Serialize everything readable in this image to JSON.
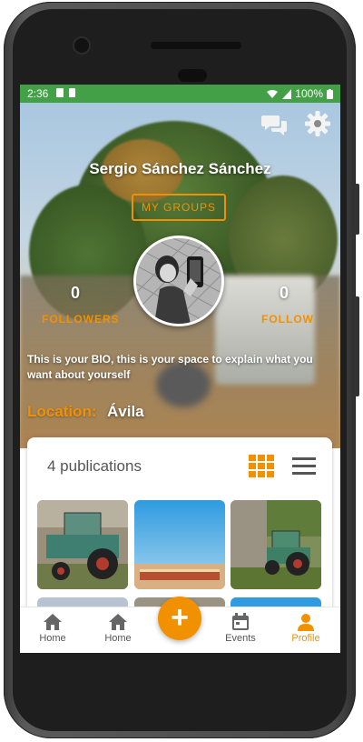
{
  "status_bar": {
    "time": "2:36",
    "battery": "100%"
  },
  "profile": {
    "name": "Sergio Sánchez Sánchez",
    "groups_label": "MY GROUPS",
    "followers": {
      "count": "0",
      "label": "FOLLOWERS"
    },
    "follow": {
      "count": "0",
      "label": "FOLLOW"
    },
    "bio": "This is your BIO, this is your space to explain what you want about yourself",
    "location_label": "Location:",
    "location": "Ávila"
  },
  "publications": {
    "count_text": "4 publications"
  },
  "nav": {
    "items": [
      {
        "label": "Home",
        "icon": "home-icon"
      },
      {
        "label": "Home",
        "icon": "home-icon"
      },
      {
        "label": "Events",
        "icon": "calendar-icon"
      },
      {
        "label": "Profile",
        "icon": "person-icon"
      }
    ],
    "fab_label": "+"
  },
  "colors": {
    "accent": "#f29100",
    "status_bar": "#43a047",
    "text_dark": "#555555"
  }
}
